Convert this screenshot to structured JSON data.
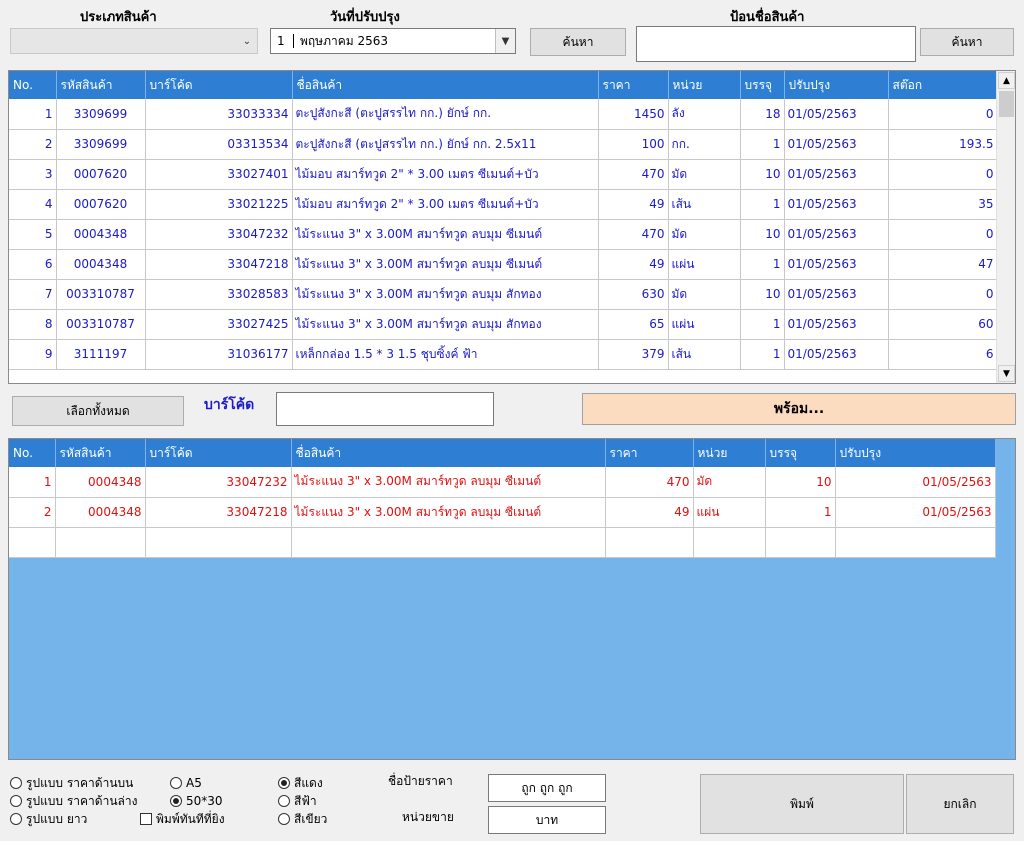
{
  "filters": {
    "category_label": "ประเภทสินค้า",
    "category_value": "",
    "date_label": "วันที่ปรับปรุง",
    "date_day": "1",
    "date_value": "พฤษภาคม  2563",
    "search_button": "ค้นหา",
    "name_label": "ป้อนชื่อสินค้า",
    "name_value": "",
    "name_search_button": "ค้นหา"
  },
  "top_table": {
    "headers": [
      "No.",
      "รหัสสินค้า",
      "บาร์โค้ด",
      "ชื่อสินค้า",
      "ราคา",
      "หน่วย",
      "บรรจุ",
      "ปรับปรุง",
      "สต๊อก"
    ],
    "rows": [
      [
        "1",
        "3309699",
        "33033334",
        "ตะปูสังกะสี (ตะปูสรรไท กก.) ยักษ์ กก.",
        "1450",
        "ลัง",
        "18",
        "01/05/2563",
        "0"
      ],
      [
        "2",
        "3309699",
        "03313534",
        "ตะปูสังกะสี (ตะปูสรรไท กก.) ยักษ์ กก. 2.5x11",
        "100",
        "กก.",
        "1",
        "01/05/2563",
        "193.5"
      ],
      [
        "3",
        "0007620",
        "33027401",
        "ไม้มอบ สมาร์ทวูด 2\" * 3.00 เมตร  ซีเมนต์+บัว",
        "470",
        "มัด",
        "10",
        "01/05/2563",
        "0"
      ],
      [
        "4",
        "0007620",
        "33021225",
        "ไม้มอบ สมาร์ทวูด 2\" * 3.00 เมตร  ซีเมนต์+บัว",
        "49",
        "เส้น",
        "1",
        "01/05/2563",
        "35"
      ],
      [
        "5",
        "0004348",
        "33047232",
        "ไม้ระแนง 3\" x 3.00M สมาร์ทวูด ลบมุม ซีเมนต์",
        "470",
        "มัด",
        "10",
        "01/05/2563",
        "0"
      ],
      [
        "6",
        "0004348",
        "33047218",
        "ไม้ระแนง 3\" x 3.00M สมาร์ทวูด ลบมุม ซีเมนต์",
        "49",
        "แผ่น",
        "1",
        "01/05/2563",
        "47"
      ],
      [
        "7",
        "003310787",
        "33028583",
        "ไม้ระแนง 3\" x 3.00M สมาร์ทวูด ลบมุม สักทอง",
        "630",
        "มัด",
        "10",
        "01/05/2563",
        "0"
      ],
      [
        "8",
        "003310787",
        "33027425",
        "ไม้ระแนง 3\" x 3.00M สมาร์ทวูด ลบมุม สักทอง",
        "65",
        "แผ่น",
        "1",
        "01/05/2563",
        "60"
      ],
      [
        "9",
        "3111197",
        "31036177",
        "เหล็กกล่อง 1.5 * 3  1.5 ชุบซิ้งค์  ฟ้า",
        "379",
        "เส้น",
        "1",
        "01/05/2563",
        "6"
      ]
    ]
  },
  "middle": {
    "select_all_button": "เลือกทั้งหมด",
    "barcode_label": "บาร์โค้ด",
    "barcode_value": "",
    "status": "พร้อม..."
  },
  "bottom_table": {
    "headers": [
      "No.",
      "รหัสสินค้า",
      "บาร์โค้ด",
      "ชื่อสินค้า",
      "ราคา",
      "หน่วย",
      "บรรจุ",
      "ปรับปรุง"
    ],
    "rows": [
      [
        "1",
        "0004348",
        "33047232",
        "ไม้ระแนง 3\" x 3.00M สมาร์ทวูด ลบมุม ซีเมนต์",
        "470",
        "มัด",
        "10",
        "01/05/2563"
      ],
      [
        "2",
        "0004348",
        "33047218",
        "ไม้ระแนง 3\" x 3.00M สมาร์ทวูด ลบมุม ซีเมนต์",
        "49",
        "แผ่น",
        "1",
        "01/05/2563"
      ]
    ]
  },
  "options": {
    "layout_top": "รูปแบบ ราคาด้านบน",
    "layout_bottom": "รูปแบบ ราคาด้านล่าง",
    "layout_long": "รูปแบบ ยาว",
    "size_a5": "A5",
    "size_50x30": "50*30",
    "print_immediately": "พิมพ์ทันทีที่ยิง",
    "color_red": "สีแดง",
    "color_blue": "สีฟ้า",
    "color_green": "สีเขียว",
    "tag_name_label": "ชื่อป้ายราคา",
    "tag_name_value": "ถูก ถูก ถูก",
    "unit_label": "หน่วยขาย",
    "unit_value": "บาท",
    "print_button": "พิมพ์",
    "cancel_button": "ยกเลิก"
  },
  "colors": {
    "header_blue": "#2e7fd4",
    "panel_blue": "#74b4ea",
    "status_bg": "#fcdcc0",
    "top_text": "#1a1ac8",
    "bottom_text": "#e01010"
  }
}
